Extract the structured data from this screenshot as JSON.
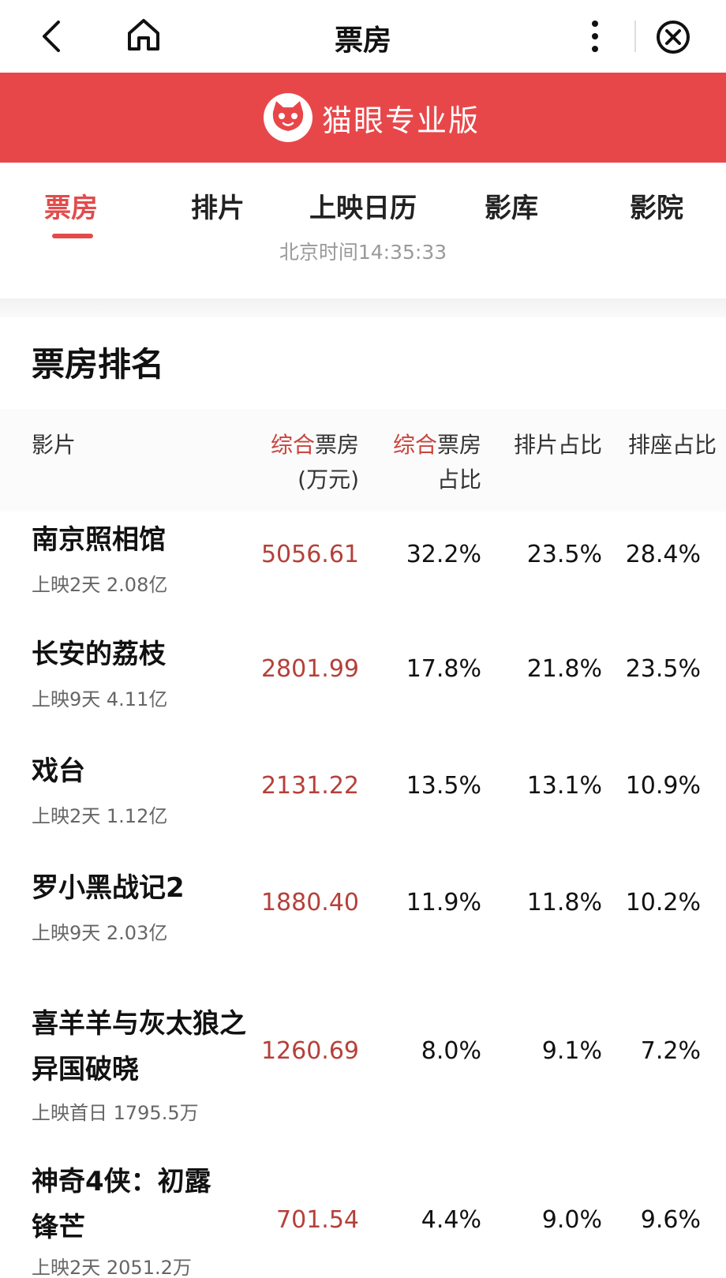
{
  "topbar": {
    "title": "票房"
  },
  "banner": {
    "brand": "猫眼专业版"
  },
  "tabs": [
    "票房",
    "排片",
    "上映日历",
    "影库",
    "影院"
  ],
  "time": "北京时间14:35:33",
  "section_title": "票房排名",
  "table": {
    "headers": {
      "film": "影片",
      "box_hl": "综合",
      "box_rest": "票房",
      "box_unit": "(万元)",
      "share_hl": "综合",
      "share_rest": "票房",
      "share_line2": "占比",
      "sched": "排片占比",
      "seat": "排座占比"
    },
    "rows": [
      {
        "name": "南京照相馆",
        "sub": "上映2天  2.08亿",
        "box": "5056.61",
        "share": "32.2%",
        "sched": "23.5%",
        "seat": "28.4%"
      },
      {
        "name": "长安的荔枝",
        "sub": "上映9天  4.11亿",
        "box": "2801.99",
        "share": "17.8%",
        "sched": "21.8%",
        "seat": "23.5%"
      },
      {
        "name": "戏台",
        "sub": "上映2天  1.12亿",
        "box": "2131.22",
        "share": "13.5%",
        "sched": "13.1%",
        "seat": "10.9%"
      },
      {
        "name": "罗小黑战记2",
        "sub": "上映9天  2.03亿",
        "box": "1880.40",
        "share": "11.9%",
        "sched": "11.8%",
        "seat": "10.2%"
      },
      {
        "name": "喜羊羊与灰太狼之异国破晓",
        "sub": "上映首日  1795.5万",
        "box": "1260.69",
        "share": "8.0%",
        "sched": "9.1%",
        "seat": "7.2%"
      },
      {
        "name": "神奇4侠：初露锋芒",
        "sub": "上映2天  2051.2万",
        "box": "701.54",
        "share": "4.4%",
        "sched": "9.0%",
        "seat": "9.6%"
      }
    ]
  },
  "colors": {
    "brand_red": "#e8474a",
    "accent": "#e34b4b",
    "value_red": "#b5403a"
  }
}
